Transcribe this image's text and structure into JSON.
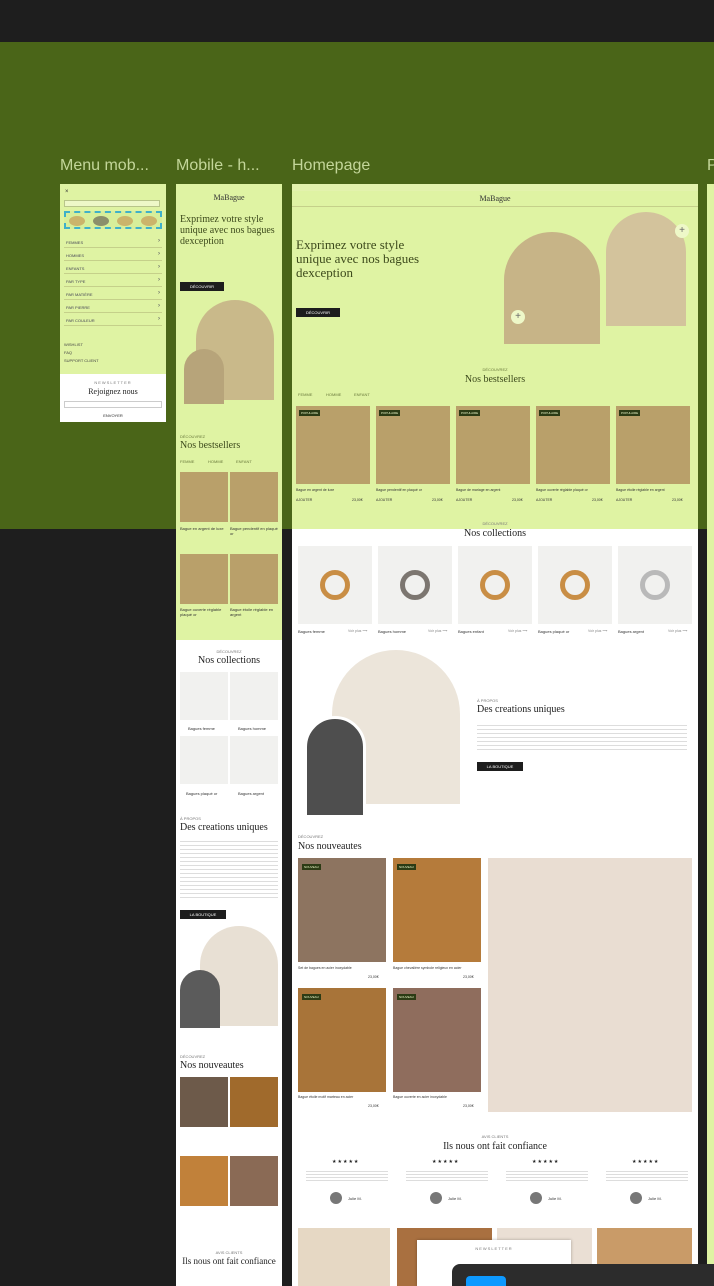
{
  "frames": {
    "menu_mobile": "Menu mob...",
    "mobile_home": "Mobile - h...",
    "homepage": "Homepage",
    "partial": "P"
  },
  "brand": "MaBague",
  "hero": {
    "title_line1": "Exprimez votre style",
    "title_line2": "unique avec nos bagues",
    "title_line3": "dexception",
    "cta": "DÉCOUVRIR"
  },
  "menu": {
    "items": [
      "FEMMES",
      "HOMMES",
      "ENFANTS",
      "PAR TYPE",
      "PAR MATIÈRE",
      "PAR PIERRE",
      "PAR COULEUR"
    ],
    "links": [
      "WISHLIST",
      "FAQ",
      "SUPPORT CLIENT"
    ],
    "newsletter_small": "NEWSLETTER",
    "newsletter_title": "Rejoignez nous",
    "newsletter_button": "ENVOYER"
  },
  "bestsellers": {
    "eyebrow": "DÉCOUVREZ",
    "title": "Nos bestsellers",
    "tabs": [
      "FEMME",
      "HOMME",
      "ENFANT"
    ],
    "products": [
      {
        "name": "Bague en argent de luxe",
        "price": "23,00€",
        "tag": "POPULAIRE"
      },
      {
        "name": "Bague pendentif en plaqué or",
        "price": "23,00€",
        "tag": "POPULAIRE"
      },
      {
        "name": "Bague de mariage en argent",
        "price": "23,00€",
        "tag": "POPULAIRE"
      },
      {
        "name": "Bague ouverte réglable plaqué or",
        "price": "23,00€",
        "tag": "POPULAIRE"
      },
      {
        "name": "Bague étoile réglable en argent",
        "price": "23,00€",
        "tag": "POPULAIRE"
      }
    ],
    "add_label": "AJOUTER"
  },
  "collections": {
    "eyebrow": "DÉCOUVREZ",
    "title": "Nos collections",
    "items": [
      "Bagues femme",
      "Bagues homme",
      "Bagues enfant",
      "Bagues plaqué or",
      "Bagues argent"
    ],
    "more": "Voir plus"
  },
  "about": {
    "eyebrow": "À PROPOS",
    "title": "Des creations uniques",
    "cta": "LA BOUTIQUE"
  },
  "news": {
    "eyebrow": "DÉCOUVREZ",
    "title": "Nos nouveautes",
    "products": [
      {
        "name": "Set de bagues en acier inoxydable",
        "price": "23,00€",
        "tag": "NOUVEAU"
      },
      {
        "name": "Bague chevalière symbole religieux en acier",
        "price": "23,00€",
        "tag": "NOUVEAU"
      },
      {
        "name": "Bague étoile motif marteau en acier",
        "price": "23,00€",
        "tag": "NOUVEAU"
      },
      {
        "name": "Bague ouverte en acier inoxydable",
        "price": "23,00€",
        "tag": "NOUVEAU"
      }
    ]
  },
  "reviews": {
    "eyebrow": "AVIS CLIENTS",
    "title": "Ils nous ont fait confiance",
    "stars": "★★★★★",
    "reviewer": "Julie M."
  },
  "newsletter_home": {
    "eyebrow": "NEWSLETTER"
  },
  "colors": {
    "canvas": "#1e1e1e",
    "band": "#4a6518",
    "highlight": "#dff3a3",
    "label": "#c3d699"
  }
}
